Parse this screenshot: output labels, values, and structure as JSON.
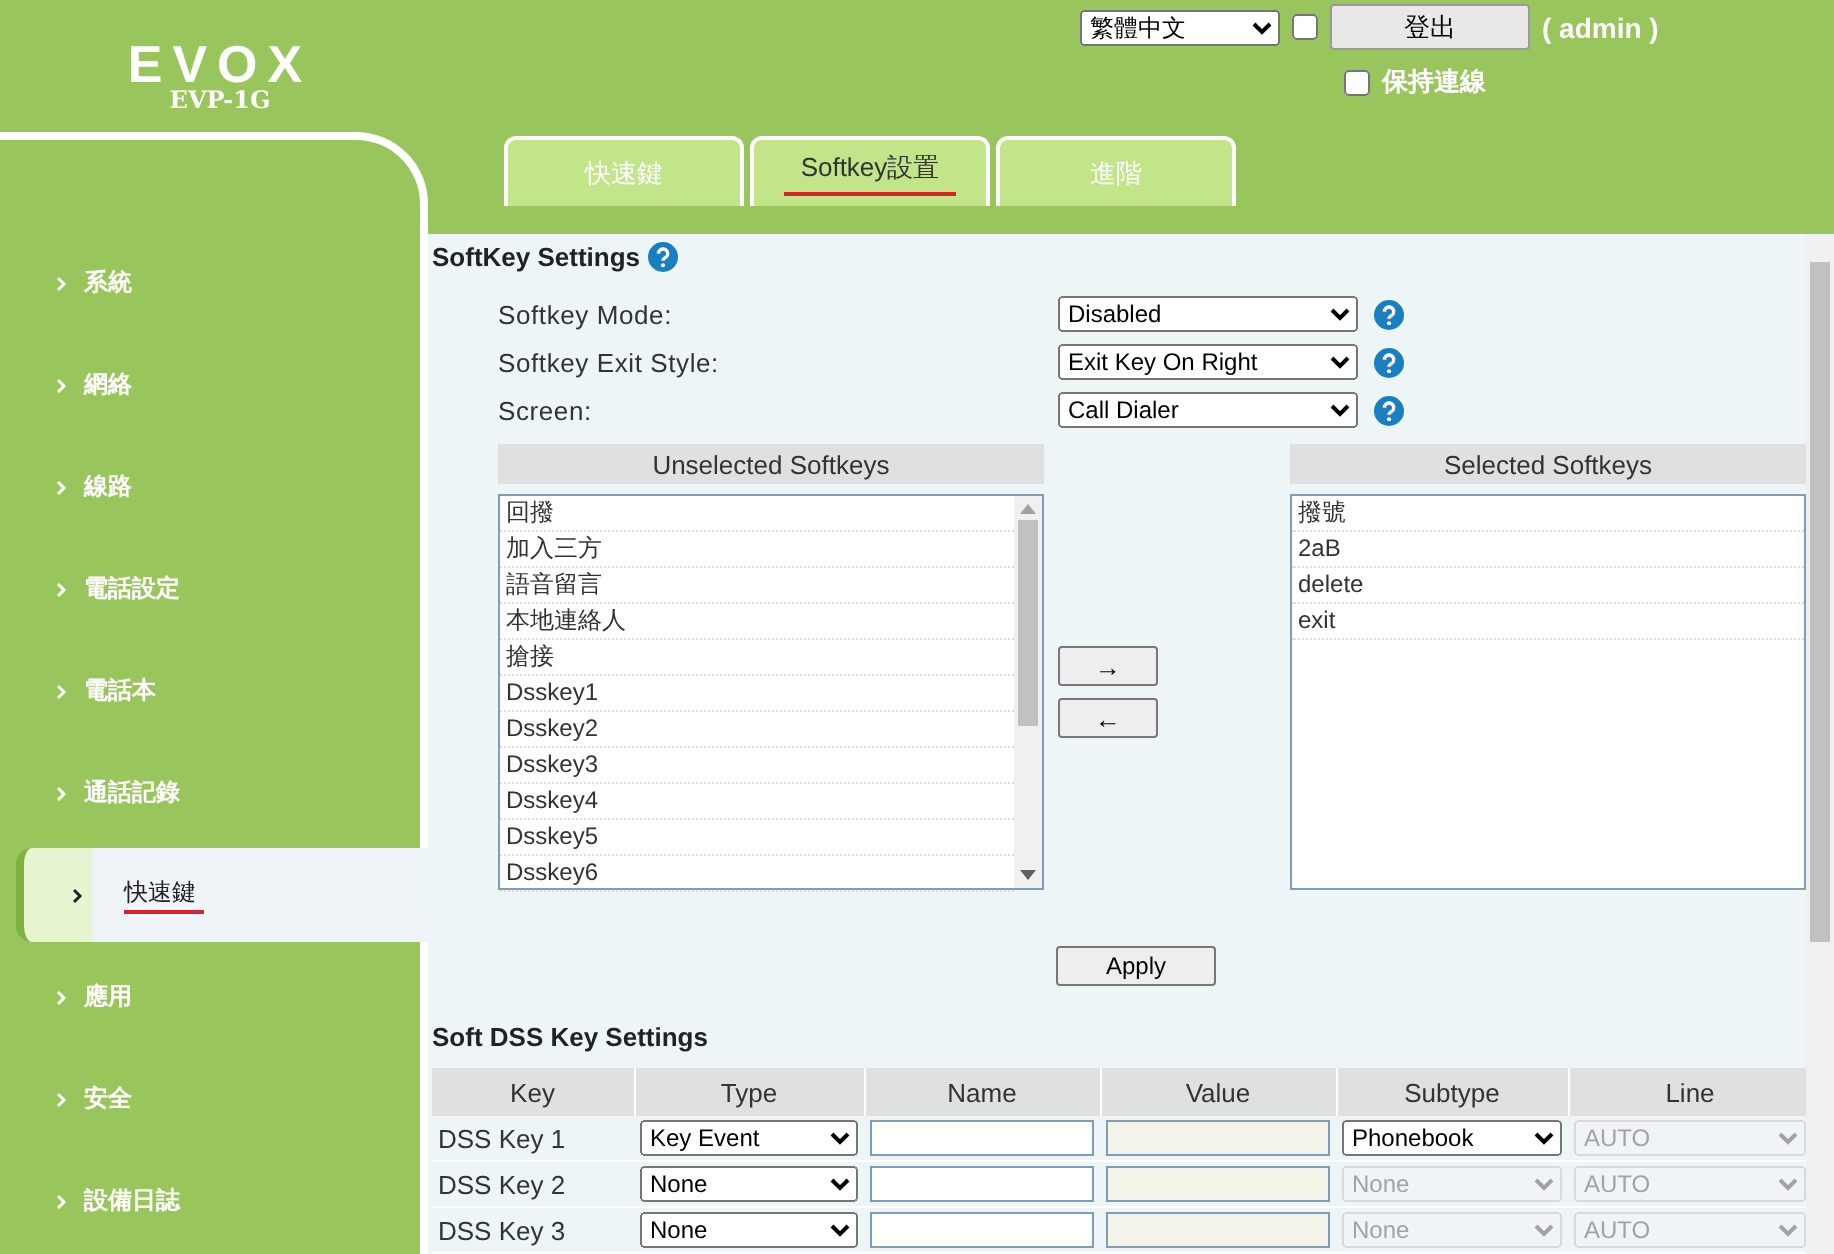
{
  "header": {
    "logo": "EVOX",
    "model": "EVP-1G",
    "language": "繁體中文",
    "remember_checked": false,
    "logout": "登出",
    "user": "( admin )",
    "keep_login": {
      "label": "保持連線",
      "checked": false
    }
  },
  "tabs": [
    {
      "label": "快速鍵",
      "selected": false
    },
    {
      "label": "Softkey設置",
      "selected": true
    },
    {
      "label": "進階",
      "selected": false
    }
  ],
  "sidebar": {
    "items": [
      {
        "label": "系統",
        "selected": false
      },
      {
        "label": "網絡",
        "selected": false
      },
      {
        "label": "線路",
        "selected": false
      },
      {
        "label": "電話設定",
        "selected": false
      },
      {
        "label": "電話本",
        "selected": false
      },
      {
        "label": "通話記錄",
        "selected": false
      },
      {
        "label": "快速鍵",
        "selected": true
      },
      {
        "label": "應用",
        "selected": false
      },
      {
        "label": "安全",
        "selected": false
      },
      {
        "label": "設備日誌",
        "selected": false
      }
    ]
  },
  "softkey_settings": {
    "title": "SoftKey Settings",
    "fields": [
      {
        "label": "Softkey Mode:",
        "value": "Disabled"
      },
      {
        "label": "Softkey Exit Style:",
        "value": "Exit Key On Right"
      },
      {
        "label": "Screen:",
        "value": "Call Dialer"
      }
    ],
    "unselected": {
      "title": "Unselected Softkeys",
      "items": [
        "回撥",
        "加入三方",
        "語音留言",
        "本地連絡人",
        "搶接",
        "Dsskey1",
        "Dsskey2",
        "Dsskey3",
        "Dsskey4",
        "Dsskey5",
        "Dsskey6"
      ]
    },
    "move_buttons": [
      "→",
      "←"
    ],
    "selected": {
      "title": "Selected Softkeys",
      "items": [
        "撥號",
        "2aB",
        "delete",
        "exit"
      ]
    },
    "apply": "Apply"
  },
  "dss_settings": {
    "title": "Soft DSS Key Settings",
    "columns": [
      "Key",
      "Type",
      "Name",
      "Value",
      "Subtype",
      "Line"
    ],
    "rows": [
      {
        "key": "DSS Key 1",
        "type": {
          "value": "Key Event",
          "disabled": false
        },
        "subtype": {
          "value": "Phonebook",
          "disabled": false
        },
        "line": {
          "value": "AUTO",
          "disabled": true
        }
      },
      {
        "key": "DSS Key 2",
        "type": {
          "value": "None",
          "disabled": false
        },
        "subtype": {
          "value": "None",
          "disabled": true
        },
        "line": {
          "value": "AUTO",
          "disabled": true
        }
      },
      {
        "key": "DSS Key 3",
        "type": {
          "value": "None",
          "disabled": false
        },
        "subtype": {
          "value": "None",
          "disabled": true
        },
        "line": {
          "value": "AUTO",
          "disabled": true
        }
      }
    ]
  }
}
